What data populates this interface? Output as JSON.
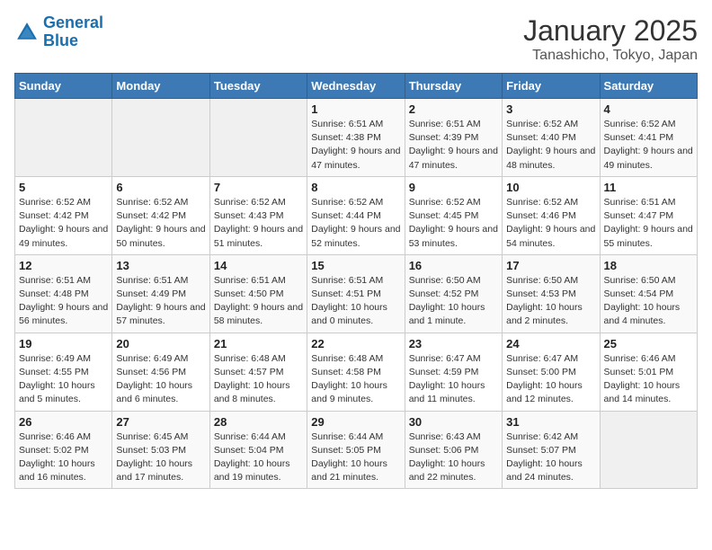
{
  "header": {
    "logo_line1": "General",
    "logo_line2": "Blue",
    "title": "January 2025",
    "subtitle": "Tanashicho, Tokyo, Japan"
  },
  "days_of_week": [
    "Sunday",
    "Monday",
    "Tuesday",
    "Wednesday",
    "Thursday",
    "Friday",
    "Saturday"
  ],
  "weeks": [
    [
      {
        "day": "",
        "info": ""
      },
      {
        "day": "",
        "info": ""
      },
      {
        "day": "",
        "info": ""
      },
      {
        "day": "1",
        "info": "Sunrise: 6:51 AM\nSunset: 4:38 PM\nDaylight: 9 hours and 47 minutes."
      },
      {
        "day": "2",
        "info": "Sunrise: 6:51 AM\nSunset: 4:39 PM\nDaylight: 9 hours and 47 minutes."
      },
      {
        "day": "3",
        "info": "Sunrise: 6:52 AM\nSunset: 4:40 PM\nDaylight: 9 hours and 48 minutes."
      },
      {
        "day": "4",
        "info": "Sunrise: 6:52 AM\nSunset: 4:41 PM\nDaylight: 9 hours and 49 minutes."
      }
    ],
    [
      {
        "day": "5",
        "info": "Sunrise: 6:52 AM\nSunset: 4:42 PM\nDaylight: 9 hours and 49 minutes."
      },
      {
        "day": "6",
        "info": "Sunrise: 6:52 AM\nSunset: 4:42 PM\nDaylight: 9 hours and 50 minutes."
      },
      {
        "day": "7",
        "info": "Sunrise: 6:52 AM\nSunset: 4:43 PM\nDaylight: 9 hours and 51 minutes."
      },
      {
        "day": "8",
        "info": "Sunrise: 6:52 AM\nSunset: 4:44 PM\nDaylight: 9 hours and 52 minutes."
      },
      {
        "day": "9",
        "info": "Sunrise: 6:52 AM\nSunset: 4:45 PM\nDaylight: 9 hours and 53 minutes."
      },
      {
        "day": "10",
        "info": "Sunrise: 6:52 AM\nSunset: 4:46 PM\nDaylight: 9 hours and 54 minutes."
      },
      {
        "day": "11",
        "info": "Sunrise: 6:51 AM\nSunset: 4:47 PM\nDaylight: 9 hours and 55 minutes."
      }
    ],
    [
      {
        "day": "12",
        "info": "Sunrise: 6:51 AM\nSunset: 4:48 PM\nDaylight: 9 hours and 56 minutes."
      },
      {
        "day": "13",
        "info": "Sunrise: 6:51 AM\nSunset: 4:49 PM\nDaylight: 9 hours and 57 minutes."
      },
      {
        "day": "14",
        "info": "Sunrise: 6:51 AM\nSunset: 4:50 PM\nDaylight: 9 hours and 58 minutes."
      },
      {
        "day": "15",
        "info": "Sunrise: 6:51 AM\nSunset: 4:51 PM\nDaylight: 10 hours and 0 minutes."
      },
      {
        "day": "16",
        "info": "Sunrise: 6:50 AM\nSunset: 4:52 PM\nDaylight: 10 hours and 1 minute."
      },
      {
        "day": "17",
        "info": "Sunrise: 6:50 AM\nSunset: 4:53 PM\nDaylight: 10 hours and 2 minutes."
      },
      {
        "day": "18",
        "info": "Sunrise: 6:50 AM\nSunset: 4:54 PM\nDaylight: 10 hours and 4 minutes."
      }
    ],
    [
      {
        "day": "19",
        "info": "Sunrise: 6:49 AM\nSunset: 4:55 PM\nDaylight: 10 hours and 5 minutes."
      },
      {
        "day": "20",
        "info": "Sunrise: 6:49 AM\nSunset: 4:56 PM\nDaylight: 10 hours and 6 minutes."
      },
      {
        "day": "21",
        "info": "Sunrise: 6:48 AM\nSunset: 4:57 PM\nDaylight: 10 hours and 8 minutes."
      },
      {
        "day": "22",
        "info": "Sunrise: 6:48 AM\nSunset: 4:58 PM\nDaylight: 10 hours and 9 minutes."
      },
      {
        "day": "23",
        "info": "Sunrise: 6:47 AM\nSunset: 4:59 PM\nDaylight: 10 hours and 11 minutes."
      },
      {
        "day": "24",
        "info": "Sunrise: 6:47 AM\nSunset: 5:00 PM\nDaylight: 10 hours and 12 minutes."
      },
      {
        "day": "25",
        "info": "Sunrise: 6:46 AM\nSunset: 5:01 PM\nDaylight: 10 hours and 14 minutes."
      }
    ],
    [
      {
        "day": "26",
        "info": "Sunrise: 6:46 AM\nSunset: 5:02 PM\nDaylight: 10 hours and 16 minutes."
      },
      {
        "day": "27",
        "info": "Sunrise: 6:45 AM\nSunset: 5:03 PM\nDaylight: 10 hours and 17 minutes."
      },
      {
        "day": "28",
        "info": "Sunrise: 6:44 AM\nSunset: 5:04 PM\nDaylight: 10 hours and 19 minutes."
      },
      {
        "day": "29",
        "info": "Sunrise: 6:44 AM\nSunset: 5:05 PM\nDaylight: 10 hours and 21 minutes."
      },
      {
        "day": "30",
        "info": "Sunrise: 6:43 AM\nSunset: 5:06 PM\nDaylight: 10 hours and 22 minutes."
      },
      {
        "day": "31",
        "info": "Sunrise: 6:42 AM\nSunset: 5:07 PM\nDaylight: 10 hours and 24 minutes."
      },
      {
        "day": "",
        "info": ""
      }
    ]
  ]
}
